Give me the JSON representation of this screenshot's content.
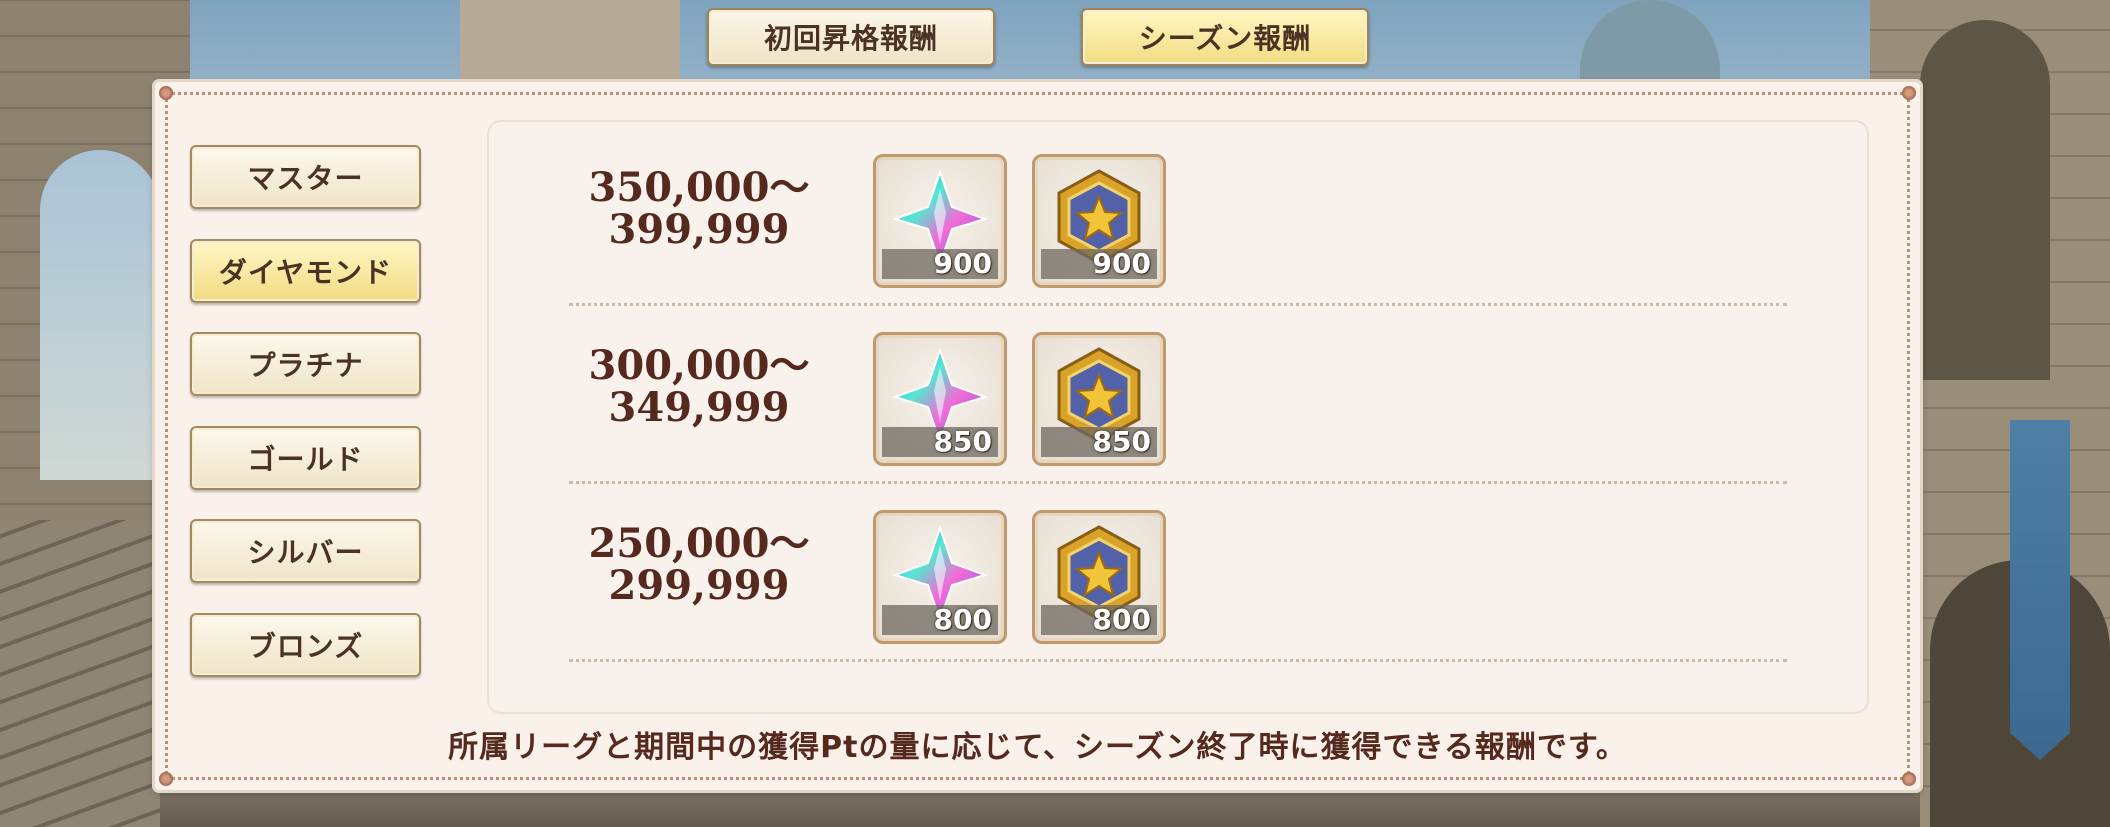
{
  "tabs": [
    {
      "label": "初回昇格報酬",
      "active": false
    },
    {
      "label": "シーズン報酬",
      "active": true
    }
  ],
  "ranks": [
    {
      "label": "マスター",
      "active": false
    },
    {
      "label": "ダイヤモンド",
      "active": true
    },
    {
      "label": "プラチナ",
      "active": false
    },
    {
      "label": "ゴールド",
      "active": false
    },
    {
      "label": "シルバー",
      "active": false
    },
    {
      "label": "ブロンズ",
      "active": false
    }
  ],
  "rewards": [
    {
      "range_top": "350,000〜",
      "range_bottom": "399,999",
      "items": [
        {
          "icon": "rainbow-crystal-icon",
          "qty": "900"
        },
        {
          "icon": "star-medal-icon",
          "qty": "900"
        }
      ]
    },
    {
      "range_top": "300,000〜",
      "range_bottom": "349,999",
      "items": [
        {
          "icon": "rainbow-crystal-icon",
          "qty": "850"
        },
        {
          "icon": "star-medal-icon",
          "qty": "850"
        }
      ]
    },
    {
      "range_top": "250,000〜",
      "range_bottom": "299,999",
      "items": [
        {
          "icon": "rainbow-crystal-icon",
          "qty": "800"
        },
        {
          "icon": "star-medal-icon",
          "qty": "800"
        }
      ]
    }
  ],
  "footer": "所属リーグと期間中の獲得Ptの量に応じて、シーズン終了時に獲得できる報酬です。",
  "colors": {
    "accent_active": "#f2dc84",
    "text_brown": "#55291e",
    "panel_bg": "#f9f1ea"
  }
}
